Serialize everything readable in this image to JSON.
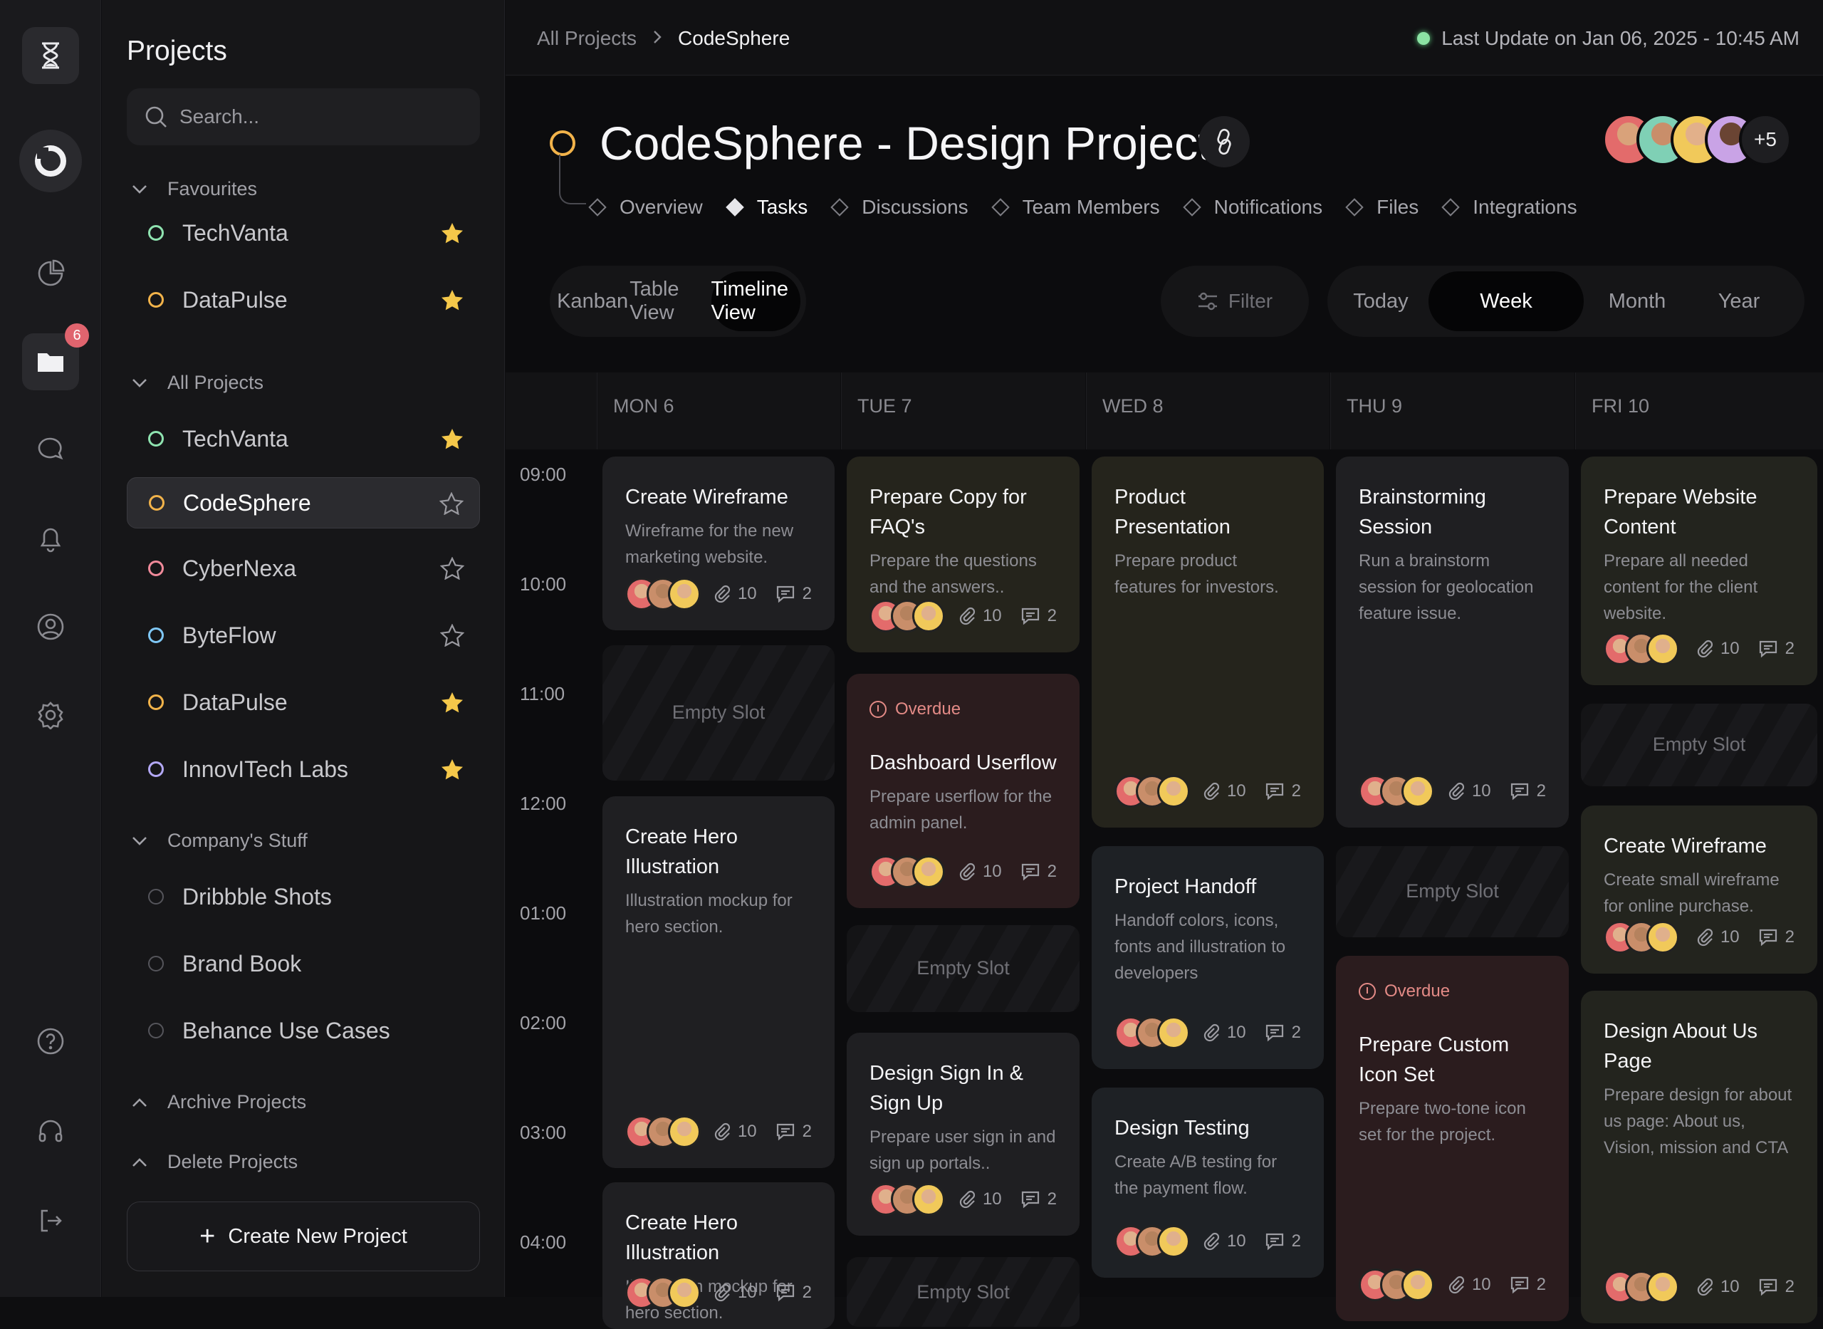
{
  "rail": {
    "badge": "6"
  },
  "sidebar": {
    "title": "Projects",
    "search_placeholder": "Search...",
    "favourites_label": "Favourites",
    "favourites": [
      {
        "name": "TechVanta",
        "color": "#8fe3b0",
        "starred": true
      },
      {
        "name": "DataPulse",
        "color": "#f2b34a",
        "starred": true
      }
    ],
    "all_label": "All Projects",
    "all": [
      {
        "name": "TechVanta",
        "color": "#8fe3b0",
        "starred": true
      },
      {
        "name": "CodeSphere",
        "color": "#f2b34a",
        "starred": false
      },
      {
        "name": "CyberNexa",
        "color": "#f08a9a",
        "starred": false
      },
      {
        "name": "ByteFlow",
        "color": "#7fc7f5",
        "starred": false
      },
      {
        "name": "DataPulse",
        "color": "#f2b34a",
        "starred": true
      },
      {
        "name": "InnovITech Labs",
        "color": "#b3a8f5",
        "starred": true
      }
    ],
    "company_label": "Company's Stuff",
    "company": [
      {
        "name": "Dribbble Shots"
      },
      {
        "name": "Brand Book"
      },
      {
        "name": "Behance Use Cases"
      }
    ],
    "archive_label": "Archive Projects",
    "delete_label": "Delete Projects",
    "create_label": "Create New Project"
  },
  "topbar": {
    "crumb_root": "All Projects",
    "crumb_current": "CodeSphere",
    "last_update": "Last Update on Jan 06, 2025 - 10:45 AM"
  },
  "project": {
    "title": "CodeSphere - Design Project",
    "more_members": "+5",
    "tabs": [
      "Overview",
      "Tasks",
      "Discussions",
      "Team Members",
      "Notifications",
      "Files",
      "Integrations"
    ]
  },
  "views": {
    "options": [
      "Kanban",
      "Table View",
      "Timeline View"
    ],
    "active": "Timeline View"
  },
  "filter_label": "Filter",
  "ranges": {
    "options": [
      "Today",
      "Week",
      "Month",
      "Year"
    ],
    "active": "Week"
  },
  "calendar": {
    "days": [
      "MON 6",
      "TUE 7",
      "WED 8",
      "THU 9",
      "FRI 10"
    ],
    "times": [
      "09:00",
      "10:00",
      "11:00",
      "12:00",
      "01:00",
      "02:00",
      "03:00",
      "04:00"
    ],
    "empty_label": "Empty Slot",
    "overdue_label": "Overdue",
    "attach": "10",
    "comments": "2",
    "cards": [
      {
        "day": 0,
        "title": "Create Wireframe",
        "desc": "Wireframe for the new marketing website."
      },
      {
        "day": 0,
        "title": "Create Hero Illustration",
        "desc": "Illustration mockup for hero section."
      },
      {
        "day": 0,
        "title": "Create Hero Illustration",
        "desc": "Illustration mockup for hero section."
      },
      {
        "day": 1,
        "title": "Prepare Copy for FAQ's",
        "desc": "Prepare the questions and the answers.."
      },
      {
        "day": 1,
        "title": "Dashboard Userflow",
        "desc": "Prepare userflow for the admin panel.",
        "overdue": true
      },
      {
        "day": 1,
        "title": "Design Sign In & Sign Up",
        "desc": "Prepare user sign in and sign up portals.."
      },
      {
        "day": 2,
        "title": "Product Presentation",
        "desc": "Prepare product features for investors."
      },
      {
        "day": 2,
        "title": "Project Handoff",
        "desc": "Handoff colors, icons, fonts and illustration to developers"
      },
      {
        "day": 2,
        "title": "Design Testing",
        "desc": "Create A/B testing for the payment flow."
      },
      {
        "day": 3,
        "title": "Brainstorming Session",
        "desc": "Run a brainstorm session for geolocation feature issue."
      },
      {
        "day": 3,
        "title": "Prepare Custom Icon Set",
        "desc": "Prepare two-tone icon set for the project.",
        "overdue": true
      },
      {
        "day": 4,
        "title": "Prepare Website Content",
        "desc": "Prepare all needed content for the client website."
      },
      {
        "day": 4,
        "title": "Create Wireframe",
        "desc": "Create small wireframe for online purchase."
      },
      {
        "day": 4,
        "title": "Design About Us Page",
        "desc": "Prepare design for about us page: About us, Vision, mission and CTA"
      }
    ]
  }
}
